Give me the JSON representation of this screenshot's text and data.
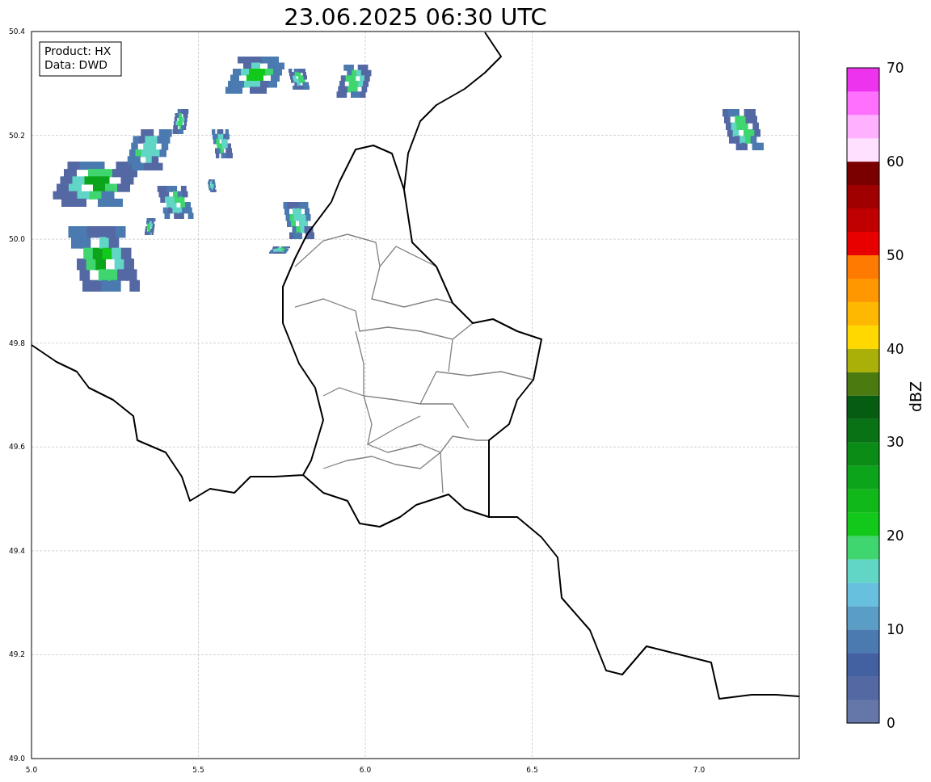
{
  "title": "23.06.2025 06:30 UTC",
  "info_box": [
    "Product: HX",
    "Data: DWD"
  ],
  "map": {
    "x_ticks": [
      "5.0",
      "5.5",
      "6.0",
      "6.5",
      "7.0"
    ],
    "y_ticks": [
      "50.4",
      "50.2",
      "50.0",
      "49.8",
      "49.6",
      "49.4",
      "49.2",
      "49.0"
    ]
  },
  "colorbar": {
    "label": "dBZ",
    "ticks": [
      "70",
      "60",
      "50",
      "40",
      "30",
      "20",
      "10",
      "0"
    ],
    "segments": [
      {
        "color": "#6577a8"
      },
      {
        "color": "#5468a4"
      },
      {
        "color": "#4360a0"
      },
      {
        "color": "#4a7ab0"
      },
      {
        "color": "#5a9ec6"
      },
      {
        "color": "#66c0de"
      },
      {
        "color": "#62d6c6"
      },
      {
        "color": "#3fd670"
      },
      {
        "color": "#12c81a"
      },
      {
        "color": "#10b81a"
      },
      {
        "color": "#0ca41a"
      },
      {
        "color": "#0a8c16"
      },
      {
        "color": "#087214"
      },
      {
        "color": "#065c10"
      },
      {
        "color": "#4a7a10"
      },
      {
        "color": "#aab008"
      },
      {
        "color": "#ffd800"
      },
      {
        "color": "#ffb800"
      },
      {
        "color": "#ff9800"
      },
      {
        "color": "#ff7a00"
      },
      {
        "color": "#e80000"
      },
      {
        "color": "#c00000"
      },
      {
        "color": "#a00000"
      },
      {
        "color": "#7a0000"
      },
      {
        "color": "#ffe0ff"
      },
      {
        "color": "#ffb0ff"
      },
      {
        "color": "#ff70ff"
      },
      {
        "color": "#ee33ee"
      }
    ]
  }
}
